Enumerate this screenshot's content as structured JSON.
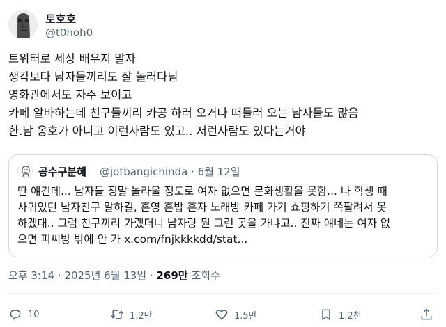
{
  "tweet": {
    "display_name": "토호호",
    "handle": "@t0hoh0",
    "lines": [
      "트위터로 세상 배우지 말자",
      "생각보다 남자들끼리도 잘 놀러다님",
      "영화관에서도 자주 보이고",
      "카페 알바하는데 친구들끼리 카공 하러 오거나 떠들러 오는 남자들도 많음",
      "한.남 옹호가 아니고 이런사람도 있고.. 저런사람도 있다는거야"
    ],
    "time": "오후 3:14",
    "dot1": "·",
    "date": "2025년 6월 13일",
    "dot2": "·",
    "views_count": "269만",
    "views_label": "조회수"
  },
  "quote": {
    "display_name": "공수구분해",
    "handle_date": "@jotbangichinda · 6월 12일",
    "lines": [
      "딴 얘긴데... 남자들 정말 놀라울 정도로 여자 없으면 문화생활을 못함... 나 학생 때",
      "사귀었던 남자친구 말하길, 혼영 혼밥 혼자 노래방 카페 가기 쇼핑하기 쪽팔려서 못",
      "하겠대.. 그럼 친구끼리 가랬더니 남자랑 뭔 그런 곳을 가냐고.. 진짜 얘네는 여자 없",
      "으면 피씨방 밖에 안 가"
    ],
    "link": "x.com/fnjkkkkdd/stat..."
  },
  "actions": {
    "reply_count": "10",
    "retweet_count": "1.2만",
    "like_count": "1.5만",
    "bookmark_count": "1.2천"
  },
  "colors": {
    "text": "#0f1419",
    "secondary": "#536471",
    "border": "#cfd9de"
  }
}
